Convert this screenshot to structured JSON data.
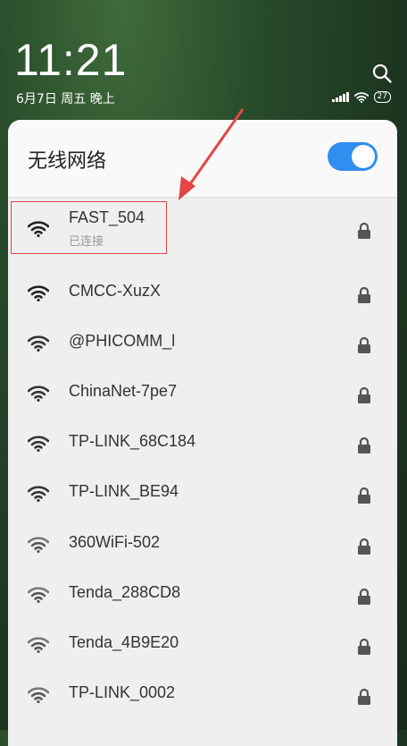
{
  "status_bar": {
    "time": "11:21",
    "date": "6月7日 周五 晚上",
    "battery": "27"
  },
  "wifi_panel": {
    "title": "无线网络",
    "toggle_on": true,
    "accent_color": "#2f8ef0",
    "networks": [
      {
        "name": "FAST_504",
        "status": "已连接",
        "signal": 3,
        "locked": true
      },
      {
        "name": "CMCC-XuzX",
        "status": "",
        "signal": 3,
        "locked": true
      },
      {
        "name": "@PHICOMM_l",
        "status": "",
        "signal": 2,
        "locked": true
      },
      {
        "name": "ChinaNet-7pe7",
        "status": "",
        "signal": 2,
        "locked": true
      },
      {
        "name": "TP-LINK_68C184",
        "status": "",
        "signal": 2,
        "locked": true
      },
      {
        "name": "TP-LINK_BE94",
        "status": "",
        "signal": 2,
        "locked": true
      },
      {
        "name": "360WiFi-502",
        "status": "",
        "signal": 1,
        "locked": true
      },
      {
        "name": "Tenda_288CD8",
        "status": "",
        "signal": 1,
        "locked": true
      },
      {
        "name": "Tenda_4B9E20",
        "status": "",
        "signal": 1,
        "locked": true
      },
      {
        "name": "TP-LINK_0002",
        "status": "",
        "signal": 1,
        "locked": true
      }
    ]
  },
  "annotation_color": "#e44646"
}
